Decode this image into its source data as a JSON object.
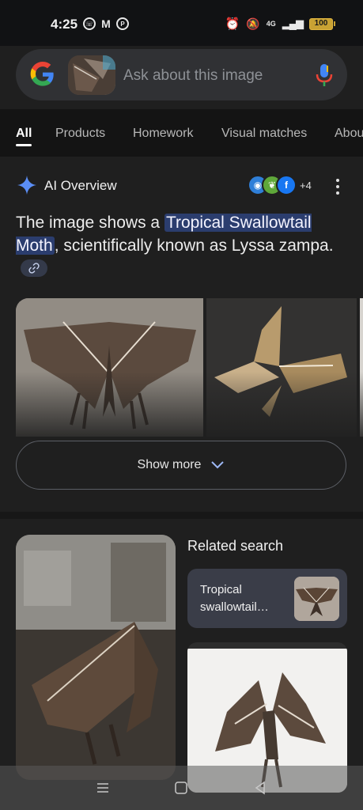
{
  "status_bar": {
    "time": "4:25",
    "left_icons": [
      "whatsapp-icon",
      "gmail-icon",
      "pinterest-icon"
    ],
    "right_icons": [
      "alarm-icon",
      "mute-icon",
      "signal-icon"
    ],
    "network": "4G",
    "battery": "100",
    "battery_color": "#c9a233"
  },
  "search": {
    "placeholder": "Ask about this image",
    "query_image": "moth thumbnail",
    "logo": "google-logo",
    "mic": "mic-icon"
  },
  "tabs": [
    {
      "label": "All",
      "active": true
    },
    {
      "label": "Products"
    },
    {
      "label": "Homework"
    },
    {
      "label": "Visual matches"
    },
    {
      "label": "Abou"
    }
  ],
  "ai_overview": {
    "title": "AI Overview",
    "sources_more": "+4",
    "text_before": "The image shows a ",
    "highlight": "Tropical Swallowtail Moth",
    "text_after": ", scientifically known as Lyssa zampa.",
    "show_more": "Show more",
    "accent_color": "#2b3d6e"
  },
  "related": {
    "title": "Related search",
    "item_label": "Tropical swallowtail…"
  }
}
